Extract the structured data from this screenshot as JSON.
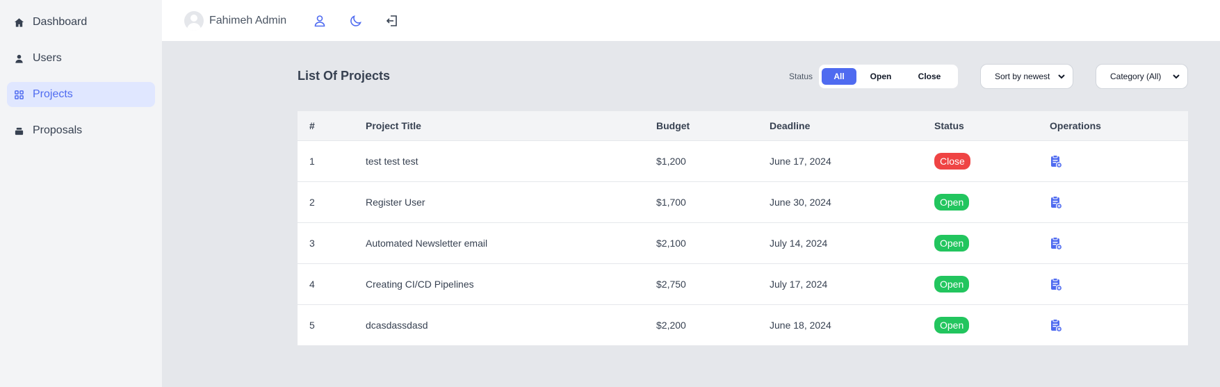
{
  "sidebar": {
    "items": [
      {
        "label": "Dashboard",
        "icon": "home-icon"
      },
      {
        "label": "Users",
        "icon": "user-icon"
      },
      {
        "label": "Projects",
        "icon": "grid-icon",
        "active": true
      },
      {
        "label": "Proposals",
        "icon": "stack-icon"
      }
    ]
  },
  "header": {
    "user_name": "Fahimeh Admin"
  },
  "page": {
    "title": "List Of Projects",
    "status_label": "Status",
    "status_options": [
      "All",
      "Open",
      "Close"
    ],
    "selected_status": "All",
    "sort_value": "Sort by newest",
    "category_value": "Category (All)"
  },
  "table": {
    "headers": [
      "#",
      "Project Title",
      "Budget",
      "Deadline",
      "Status",
      "Operations"
    ],
    "rows": [
      {
        "num": "1",
        "title": "test test test",
        "budget": "$1,200",
        "deadline": "June 17, 2024",
        "status": "Close"
      },
      {
        "num": "2",
        "title": "Register User",
        "budget": "$1,700",
        "deadline": "June 30, 2024",
        "status": "Open"
      },
      {
        "num": "3",
        "title": "Automated Newsletter email",
        "budget": "$2,100",
        "deadline": "July 14, 2024",
        "status": "Open"
      },
      {
        "num": "4",
        "title": "Creating CI/CD Pipelines",
        "budget": "$2,750",
        "deadline": "July 17, 2024",
        "status": "Open"
      },
      {
        "num": "5",
        "title": "dcasdassdasd",
        "budget": "$2,200",
        "deadline": "June 18, 2024",
        "status": "Open"
      }
    ]
  },
  "colors": {
    "accent": "#4f6bf0",
    "close": "#ef4444",
    "open": "#22c55e"
  }
}
